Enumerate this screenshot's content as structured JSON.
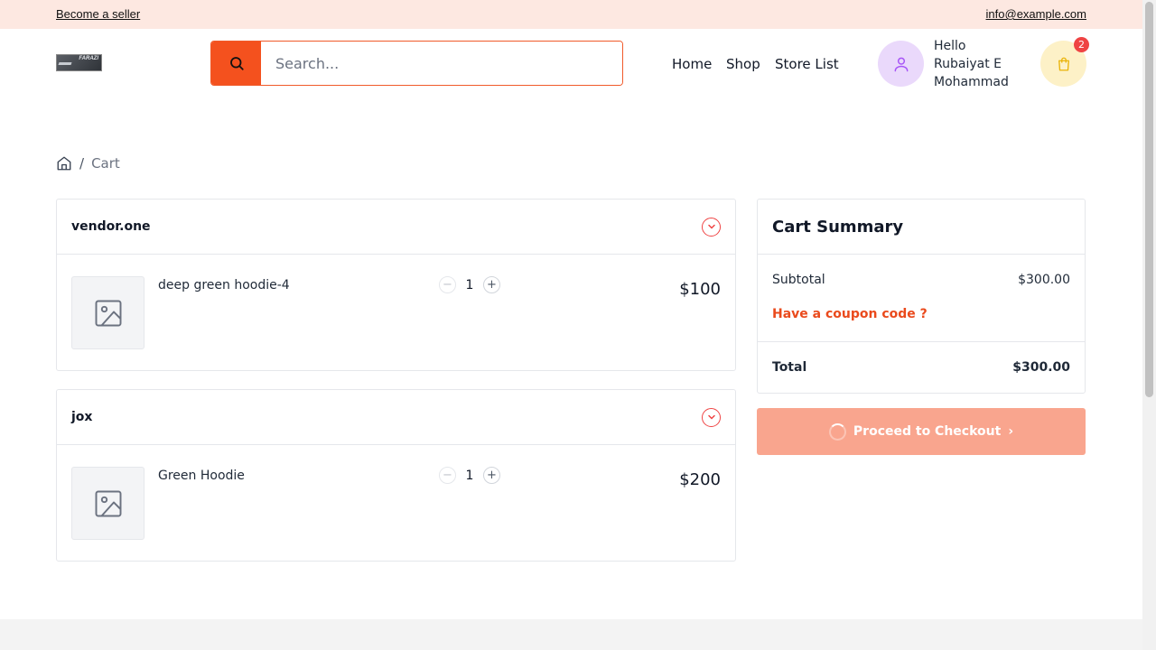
{
  "topbar": {
    "become_seller": "Become a seller",
    "email": "info@example.com"
  },
  "header": {
    "logo_text": "FARAZI",
    "search_placeholder": "Search...",
    "nav": [
      "Home",
      "Shop",
      "Store List"
    ],
    "user_greeting_line1": "Hello",
    "user_name_line1": "Rubaiyat E",
    "user_name_line2": "Mohammad",
    "cart_count": "2"
  },
  "breadcrumb": {
    "separator": "/",
    "current": "Cart"
  },
  "vendors": [
    {
      "name": "vendor.one",
      "item": {
        "name": "deep green hoodie-4",
        "qty": "1",
        "price": "$100"
      }
    },
    {
      "name": "jox",
      "item": {
        "name": "Green Hoodie",
        "qty": "1",
        "price": "$200"
      }
    }
  ],
  "summary": {
    "title": "Cart Summary",
    "subtotal_label": "Subtotal",
    "subtotal_value": "$300.00",
    "coupon": "Have a coupon code ?",
    "total_label": "Total",
    "total_value": "$300.00"
  },
  "checkout": {
    "label": "Proceed to Checkout",
    "arrow": "›"
  },
  "colors": {
    "accent": "#f4511e",
    "topbar_bg": "#fde8e1",
    "checkout_bg": "#f9a58e"
  }
}
